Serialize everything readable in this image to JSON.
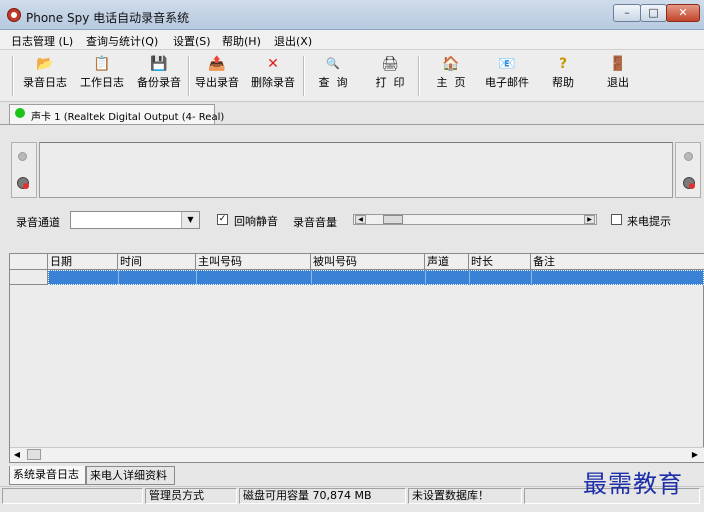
{
  "window": {
    "title": "Phone Spy 电话自动录音系统",
    "minimize": "–",
    "maximize": "□",
    "close": "✕"
  },
  "menu": [
    "日志管理 (L)",
    "查询与统计(Q)",
    "设置(S)",
    "帮助(H)",
    "退出(X)"
  ],
  "toolbar": [
    {
      "icon": "📂",
      "label": "录音日志",
      "color": "#b08a2e"
    },
    {
      "icon": "📋",
      "label": "工作日志",
      "color": "#333333"
    },
    {
      "icon": "💾",
      "label": "备份录音",
      "color": "#333333"
    },
    {
      "icon": "📤",
      "label": "导出录音",
      "color": "#333333"
    },
    {
      "icon": "✕",
      "label": "删除录音",
      "color": "#e0201a"
    },
    {
      "icon": "🔍",
      "label": "查  询",
      "color": "#4d7bc4"
    },
    {
      "icon": "🖨",
      "label": "打  印",
      "color": "#333333"
    },
    {
      "icon": "🏠",
      "label": "主  页",
      "color": "#d08a2a"
    },
    {
      "icon": "📧",
      "label": "电子邮件",
      "color": "#333333"
    },
    {
      "icon": "?",
      "label": "帮助",
      "color": "#c49a00"
    },
    {
      "icon": "🚪",
      "label": "退出",
      "color": "#c49a00"
    }
  ],
  "sound_card_tab": "声卡 1 (Realtek Digital Output (4- Real)",
  "controls": {
    "channel_label": "录音通道",
    "channel_value": "",
    "echo_mute_label": "回响静音",
    "echo_mute_checked": true,
    "volume_label": "录音音量",
    "volume_level": 0.08,
    "incoming_alert_label": "来电提示",
    "incoming_alert_checked": false
  },
  "table": {
    "columns": [
      "日期",
      "时间",
      "主叫号码",
      "被叫号码",
      "声道",
      "时长",
      "备注"
    ]
  },
  "bottom_tabs": [
    "系统录音日志",
    "来电人详细资料"
  ],
  "status": [
    "",
    "管理员方式",
    "磁盘可用容量 70,874 MB",
    "未设置数据库！",
    ""
  ],
  "watermark": "最需教育"
}
